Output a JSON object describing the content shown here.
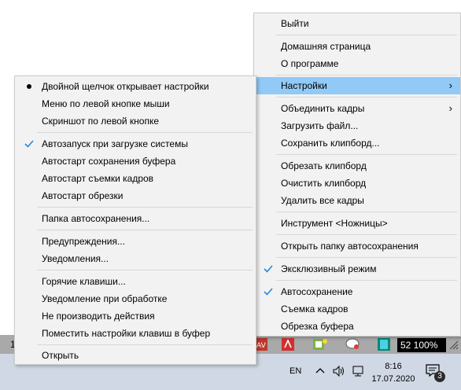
{
  "main_menu": {
    "items": [
      {
        "label": "Выйти"
      },
      {
        "label": "Домашняя страница"
      },
      {
        "label": "О программе"
      },
      {
        "label": "Настройки",
        "has_submenu": true,
        "highlighted": true
      },
      {
        "label": "Объединить кадры",
        "has_submenu": true
      },
      {
        "label": "Загрузить файл..."
      },
      {
        "label": "Сохранить клипборд..."
      },
      {
        "label": "Обрезать клипборд"
      },
      {
        "label": "Очистить клипборд"
      },
      {
        "label": "Удалить все кадры"
      },
      {
        "label": "Инструмент <Ножницы>"
      },
      {
        "label": "Открыть папку автосохранения"
      },
      {
        "label": "Эксклюзивный режим",
        "checked": true
      },
      {
        "label": "Автосохранение",
        "checked": true
      },
      {
        "label": "Съемка кадров"
      },
      {
        "label": "Обрезка буфера"
      }
    ]
  },
  "submenu": {
    "items": [
      {
        "label": "Двойной щелчок открывает настройки",
        "mark": "radio"
      },
      {
        "label": "Меню по левой кнопке мыши"
      },
      {
        "label": "Скриншот по левой кнопке"
      },
      {
        "label": "Автозапуск при загрузке системы",
        "mark": "check"
      },
      {
        "label": "Автостарт сохранения буфера"
      },
      {
        "label": "Автостарт съемки кадров"
      },
      {
        "label": "Автостарт обрезки"
      },
      {
        "label": "Папка автосохранения..."
      },
      {
        "label": "Предупреждения..."
      },
      {
        "label": "Уведомления..."
      },
      {
        "label": "Горячие клавиши..."
      },
      {
        "label": "Уведомление при обработке"
      },
      {
        "label": "Не производить действия"
      },
      {
        "label": "Поместить настройки клавиш в буфер"
      },
      {
        "label": "Открыть"
      }
    ]
  },
  "app_window": {
    "left_number": "1",
    "zoom": "52 100%"
  },
  "taskbar": {
    "language": "EN",
    "time": "8:16",
    "date": "17.07.2020",
    "notification_count": "3"
  },
  "colors": {
    "highlight": "#91c9f7",
    "check": "#1e88e5",
    "menu_bg": "#f2f2f2",
    "taskbar": "#cfd8e4"
  }
}
